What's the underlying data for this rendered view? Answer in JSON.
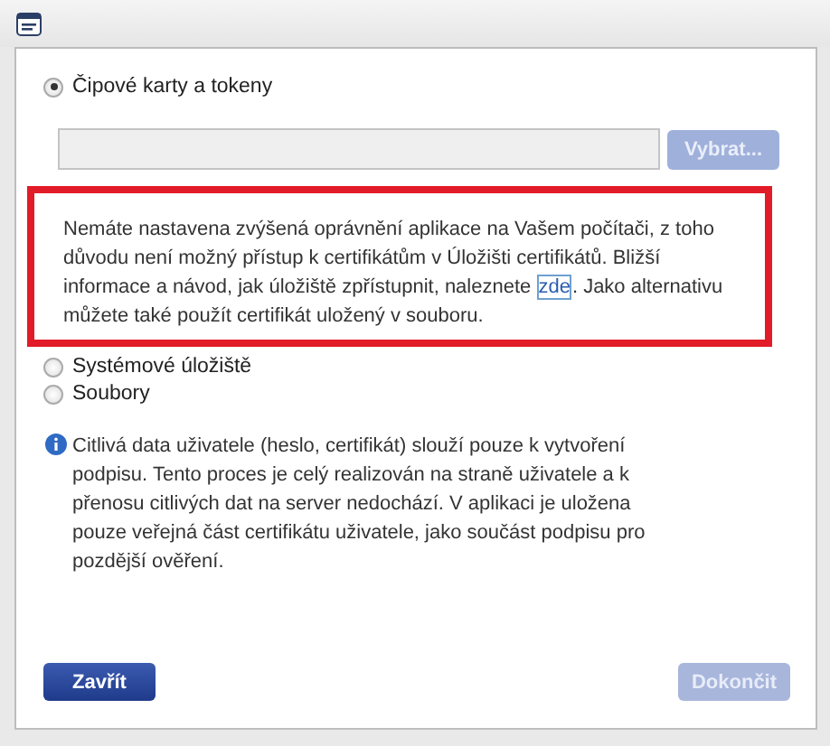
{
  "options_top": [
    {
      "label": "Čipové karty a tokeny",
      "selected": true
    }
  ],
  "choose_button": {
    "label": "Vybrat...",
    "disabled": true
  },
  "warning": {
    "before": "Nemáte nastavena zvýšená oprávnění aplikace na Vašem počítači, z toho důvodu není možný přístup k certifikátům v Úložišti certifikátů. Bližší informace a návod, jak úložiště zpřístupnit, naleznete ",
    "link": "zde",
    "after": ". Jako alternativu můžete také použít certifikát uložený v souboru."
  },
  "options_bottom": [
    {
      "label": "Systémové úložiště",
      "selected": false
    },
    {
      "label": "Soubory",
      "selected": false
    }
  ],
  "info": "Citlivá data uživatele (heslo, certifikát) slouží pouze k vytvoření podpisu. Tento proces je celý realizován na straně uživatele a k přenosu citlivých dat na server nedochází. V aplikaci je uložena pouze veřejná část certifikátu uživatele, jako součást podpisu pro pozdější ověření.",
  "buttons": [
    {
      "label": "Zavřít",
      "disabled": false
    },
    {
      "label": "Dokončit",
      "disabled": true
    }
  ]
}
